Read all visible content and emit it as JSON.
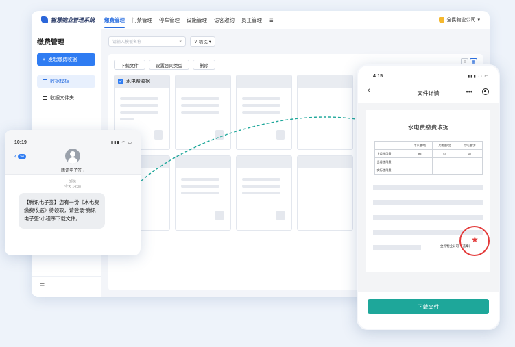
{
  "app": {
    "title": "智慧物业管理系统",
    "nav": [
      "缴费管理",
      "门禁管理",
      "停车管理",
      "设施管理",
      "访客邀约",
      "员工管理"
    ],
    "company": "全民物业公司",
    "menu_icon": "hamburger-icon"
  },
  "sidebar": {
    "title": "缴费管理",
    "primary_button": "发起缴费收据",
    "items": [
      {
        "label": "收据模板",
        "selected": true
      },
      {
        "label": "收据文件夹",
        "selected": false
      }
    ]
  },
  "search": {
    "placeholder": "请输入模板名称",
    "filter_label": "筛选"
  },
  "toolbar": {
    "download": "下载文件",
    "set_contract_type": "设置合同类型",
    "delete": "删除"
  },
  "cards": {
    "first_title": "水电费收据"
  },
  "sms": {
    "time": "10:19",
    "back_count": "54",
    "sender": "腾讯电子签",
    "type": "短信",
    "sent_time": "今天 14:38",
    "message": "【腾讯电子签】您有一份《水电费缴费收据》待领取，请登录“腾讯电子签”小程序下载文件。"
  },
  "phone": {
    "time": "4:15",
    "nav_title": "文件详情",
    "doc_title": "水电费缴费收据",
    "table": {
      "headers": [
        "",
        "用水量/吨",
        "用电量/度",
        "用气量/方"
      ],
      "rows": [
        [
          "上月使用量",
          "98",
          "44",
          "32"
        ],
        [
          "当月使用量",
          "",
          "",
          ""
        ],
        [
          "实际使用量",
          "",
          "",
          ""
        ]
      ]
    },
    "signer": "全民物业公司",
    "stamp_label": "（盖章）",
    "download_button": "下载文件"
  },
  "colors": {
    "primary": "#2f7cf2",
    "download": "#1ea79a",
    "stamp": "#e33a3a"
  }
}
